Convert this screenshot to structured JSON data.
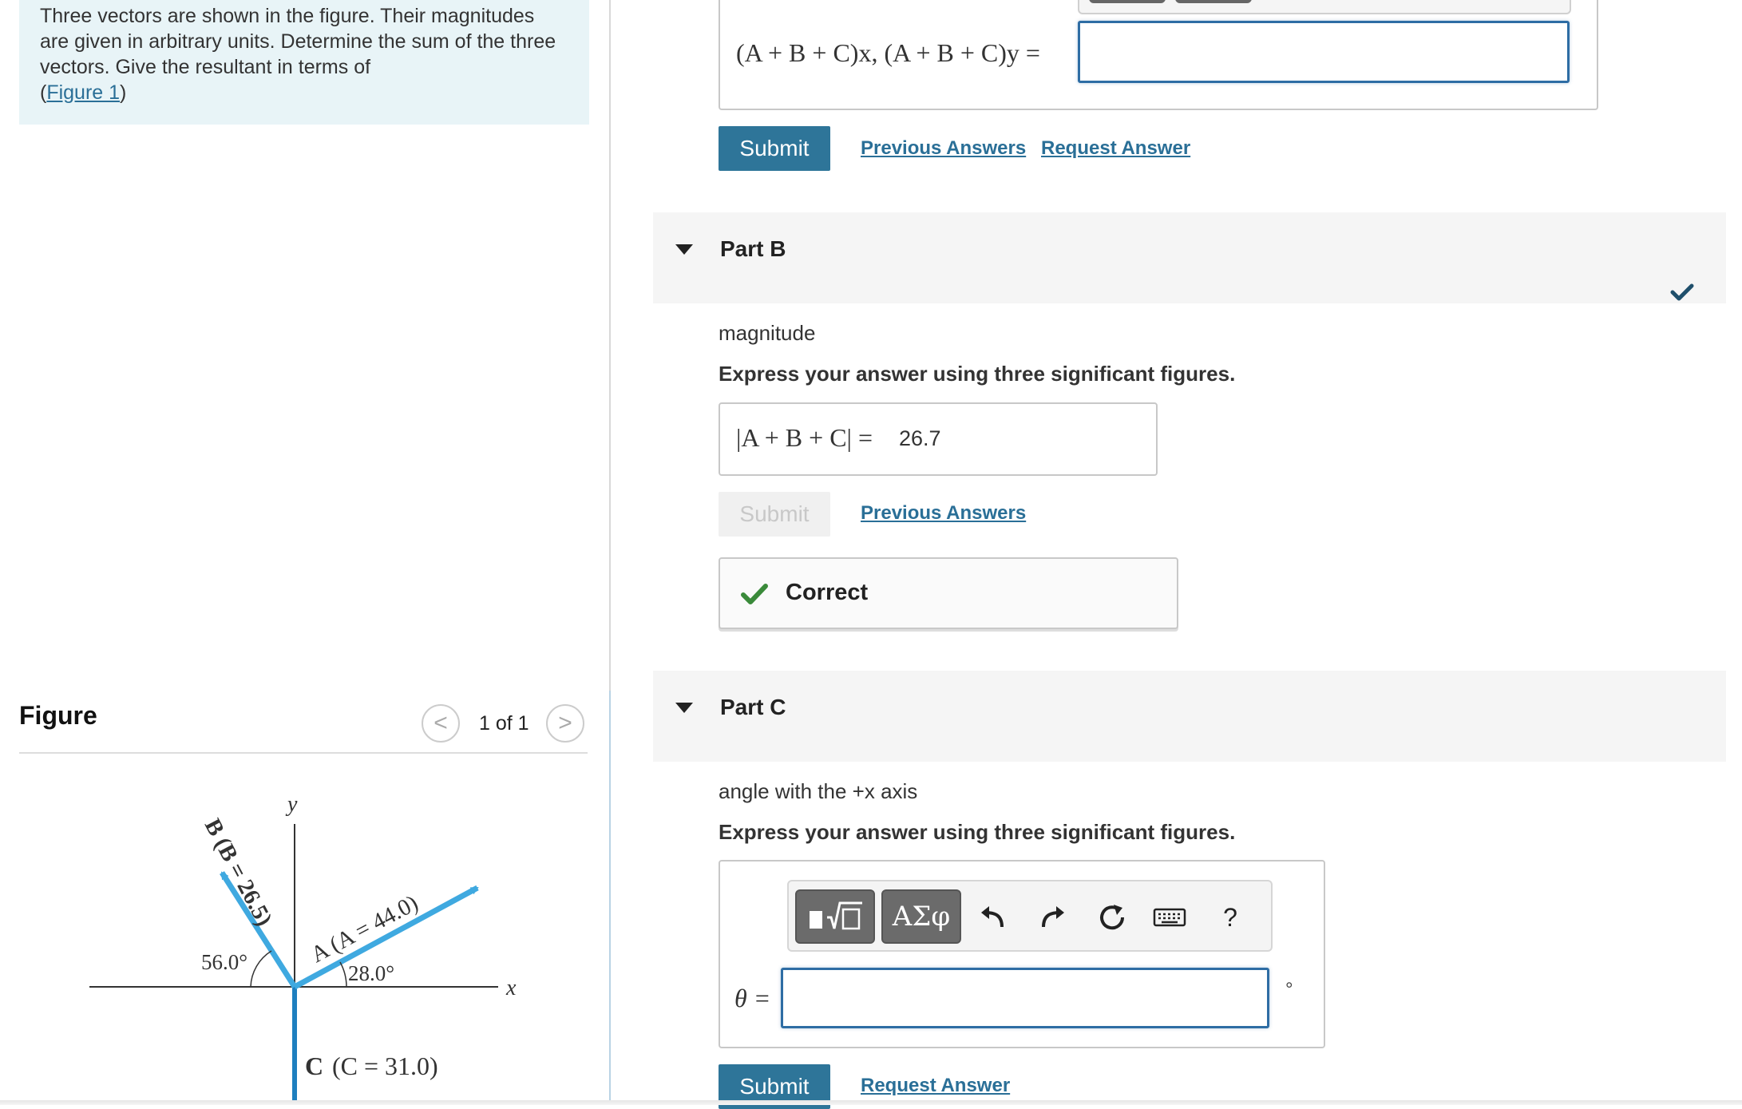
{
  "problem": {
    "text": "Three vectors are shown in the figure. Their magnitudes are given in arbitrary units. Determine the sum of the three vectors. Give the resultant in terms of",
    "figure_link_open": "(",
    "figure_link": "Figure 1",
    "figure_link_close": ")"
  },
  "figure": {
    "title": "Figure",
    "counter": "1 of 1",
    "prev_glyph": "<",
    "next_glyph": ">",
    "labels": {
      "y_axis": "y",
      "x_axis": "x",
      "vector_a": "A (A = 44.0)",
      "vector_b": "B (B = 26.5)",
      "vector_c": "(C = 31.0)",
      "vector_c_letter": "C",
      "angle_a": "28.0°",
      "angle_b": "56.0°"
    },
    "colors": {
      "vector": "#3fa9e0",
      "axis": "#333333"
    }
  },
  "part_a": {
    "label_expr": "(A + B + C)x, (A + B + C)y =",
    "input_value": "",
    "submit_label": "Submit",
    "previous_answers": "Previous Answers",
    "request_answer": "Request Answer"
  },
  "part_b": {
    "title": "Part B",
    "prompt": "magnitude",
    "instruction": "Express your answer using three significant figures.",
    "label_expr": "|A + B + C| =",
    "answer_value": "26.7",
    "submit_label": "Submit",
    "previous_answers": "Previous Answers",
    "feedback": "Correct",
    "status": "correct"
  },
  "part_c": {
    "title": "Part C",
    "prompt": "angle with the +x axis",
    "instruction": "Express your answer using three significant figures.",
    "toolbar": {
      "templates_icon": "templates-icon",
      "greek_label": "ΑΣφ",
      "undo_icon": "undo-icon",
      "redo_icon": "redo-icon",
      "reset_icon": "reset-icon",
      "keyboard_icon": "keyboard-icon",
      "help_label": "?"
    },
    "theta_label": "θ =",
    "input_value": "",
    "unit": "°",
    "submit_label": "Submit",
    "request_answer": "Request Answer"
  },
  "colors": {
    "accent": "#2e7599",
    "link": "#2a6f97",
    "check": "#3a8a3a",
    "check_dark": "#1f4f6b"
  }
}
